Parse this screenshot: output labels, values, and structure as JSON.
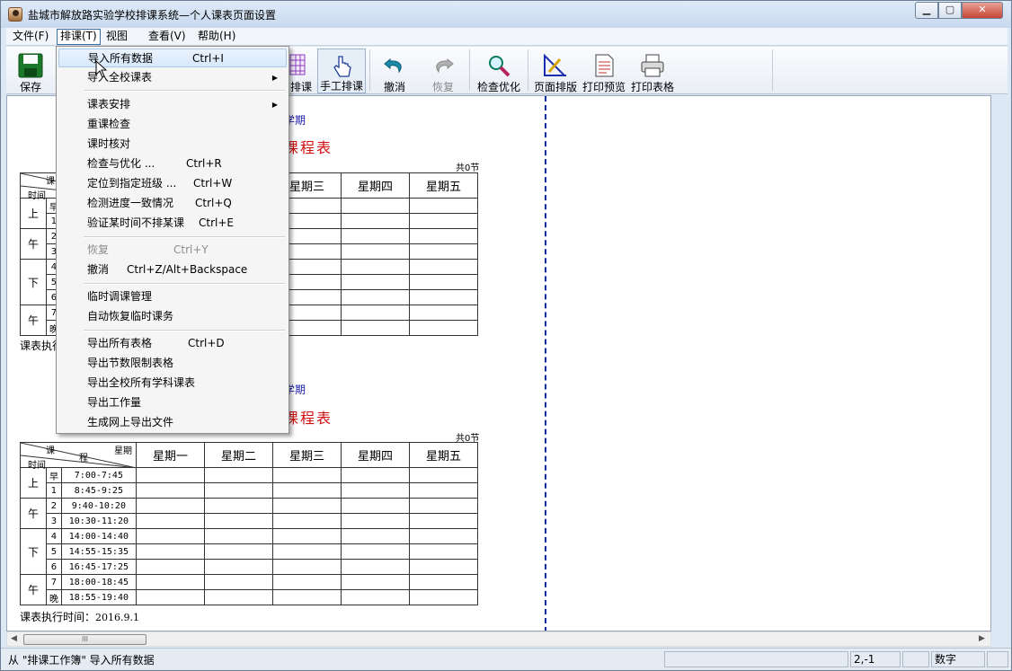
{
  "window": {
    "title": "盐城市解放路实验学校排课系统—个人课表页面设置",
    "min": "0",
    "max": "1",
    "close": "r"
  },
  "menubar": {
    "file": "文件(F)",
    "schedule": "排课(T)",
    "view": "视图",
    "query": "查看(V)",
    "help": "帮助(H)"
  },
  "toolbar": {
    "save": "保存",
    "auto_schedule_partial": "排课",
    "manual": "手工排课",
    "undo": "撤消",
    "redo": "恢复",
    "check": "检查优化",
    "layout": "页面排版",
    "preview": "打印预览",
    "print": "打印表格"
  },
  "dropdown": {
    "items": [
      {
        "label": "导入所有数据",
        "shortcut": "Ctrl+I"
      },
      {
        "label": "导入全校课表"
      },
      {
        "label": "课表安排"
      },
      {
        "label": "重课检查"
      },
      {
        "label": "课时核对"
      },
      {
        "label": "检查与优化 ...",
        "shortcut": "Ctrl+R"
      },
      {
        "label": "定位到指定班级 ...",
        "shortcut": "Ctrl+W"
      },
      {
        "label": "检测进度一致情况",
        "shortcut": "Ctrl+Q"
      },
      {
        "label": "验证某时间不排某课",
        "shortcut": "Ctrl+E"
      },
      {
        "label": "恢复",
        "shortcut": "Ctrl+Y"
      },
      {
        "label": "撤消",
        "shortcut": "Ctrl+Z/Alt+Backspace"
      },
      {
        "label": "临时调课管理"
      },
      {
        "label": "自动恢复临时课务"
      },
      {
        "label": "导出所有表格",
        "shortcut": "Ctrl+D"
      },
      {
        "label": "导出节数限制表格"
      },
      {
        "label": "导出全校所有学科课表"
      },
      {
        "label": "导出工作量"
      },
      {
        "label": "生成网上导出文件"
      }
    ]
  },
  "page": {
    "term_suffix": "学期",
    "title_partial": "课程表",
    "total": "共0节",
    "exec_time_label": "课表执行时间：",
    "exec_time_partial": "课表执行",
    "exec_date": "2016.9.1",
    "header": {
      "ke": "课",
      "xingqi": "星期",
      "cheng": "程",
      "shijian": "时间",
      "days": [
        "星期一",
        "星期二",
        "星期三",
        "星期四",
        "星期五"
      ]
    },
    "segments": {
      "am1": "上",
      "am2": "午",
      "pm1": "下",
      "pm2": "午"
    },
    "periods": [
      {
        "no": "早",
        "time": "7:00-7:45"
      },
      {
        "no": "1",
        "time": "8:45-9:25"
      },
      {
        "no": "2",
        "time": "9:40-10:20"
      },
      {
        "no": "3",
        "time": "10:30-11:20"
      },
      {
        "no": "4",
        "time": "14:00-14:40"
      },
      {
        "no": "5",
        "time": "14:55-15:35"
      },
      {
        "no": "6",
        "time": "16:45-17:25"
      },
      {
        "no": "7",
        "time": "18:00-18:45"
      },
      {
        "no": "晚",
        "time": "18:55-19:40"
      }
    ]
  },
  "scroll": {
    "up": "▲",
    "down": "▼",
    "left": "◀",
    "right": "▶",
    "hgrip": "III",
    "vgrip": "≡"
  },
  "statusbar": {
    "text": "从 \"排课工作簿\" 导入所有数据",
    "pos": "2,-1",
    "mode": "数字"
  }
}
